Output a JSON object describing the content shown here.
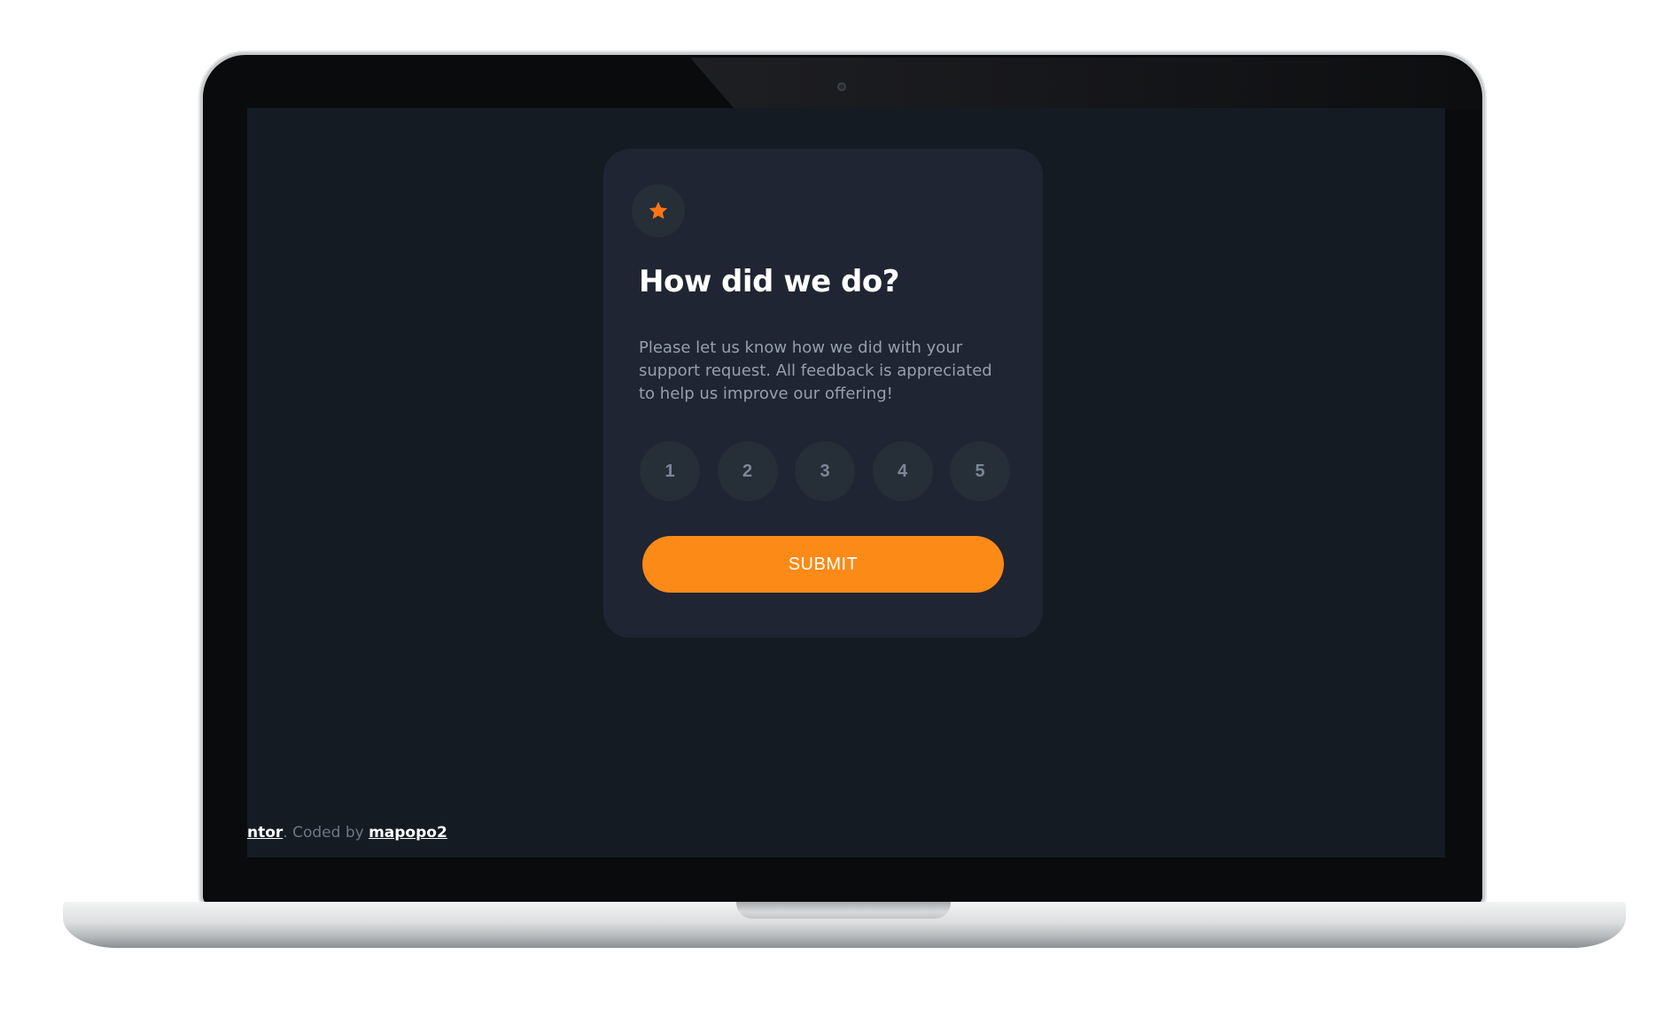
{
  "card": {
    "icon": "star-icon",
    "title": "How did we do?",
    "body": "Please let us know how we did with your support request. All feedback is appreciated to help us improve our offering!",
    "ratings": [
      "1",
      "2",
      "3",
      "4",
      "5"
    ],
    "submit_label": "SUBMIT"
  },
  "attribution": {
    "link1": "ntor",
    "separator": ". Coded by ",
    "link2": "mapopo2"
  },
  "colors": {
    "background": "#141b23",
    "card": "#1f2532",
    "accent": "#fb8a17",
    "rating_circle": "#262e38",
    "muted_text": "#969fad"
  }
}
